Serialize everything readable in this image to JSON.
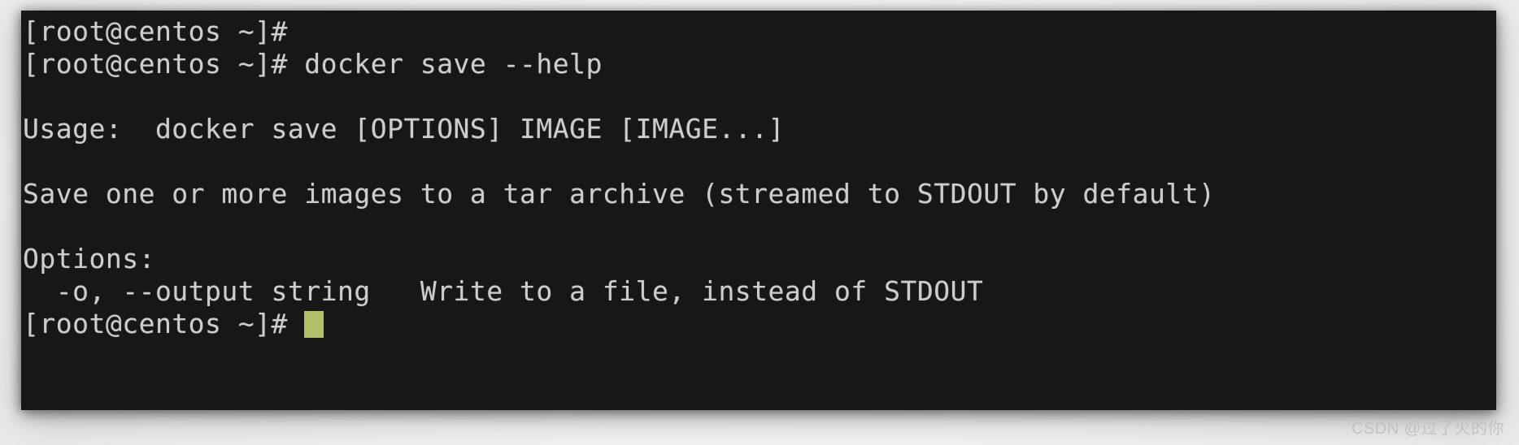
{
  "window": {
    "kind": "terminal-emulator",
    "background_color": "#171717",
    "foreground_color": "#cdcdcd",
    "cursor_color": "#b2bf69",
    "page_background_color": "#f0f0f0"
  },
  "terminal": {
    "lines": [
      {
        "id": "line-1",
        "text": "[root@centos ~]#",
        "type": "prompt"
      },
      {
        "id": "line-2",
        "text": "[root@centos ~]# docker save --help",
        "type": "command"
      },
      {
        "id": "line-3",
        "text": "",
        "type": "blank"
      },
      {
        "id": "line-4",
        "text": "Usage:  docker save [OPTIONS] IMAGE [IMAGE...]",
        "type": "output"
      },
      {
        "id": "line-5",
        "text": "",
        "type": "blank"
      },
      {
        "id": "line-6",
        "text": "Save one or more images to a tar archive (streamed to STDOUT by default)",
        "type": "output"
      },
      {
        "id": "line-7",
        "text": "",
        "type": "blank"
      },
      {
        "id": "line-8",
        "text": "Options:",
        "type": "output"
      },
      {
        "id": "line-9",
        "text": "  -o, --output string   Write to a file, instead of STDOUT",
        "type": "output"
      }
    ],
    "final_prompt": {
      "text": "[root@centos ~]# ",
      "cursor": "block"
    }
  },
  "watermark": {
    "text": "CSDN @过了火的你"
  }
}
